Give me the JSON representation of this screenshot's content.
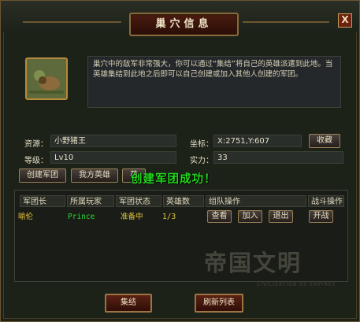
{
  "window": {
    "title": "巢穴信息",
    "close_label": "X",
    "description": "巢穴中的敌军非常强大，你可以通过“集结”将自己的英雄派遣到此地。当英雄集结到此地之后即可以自己创建或加入其他人创建的军团。"
  },
  "info": {
    "resource_label": "资源：",
    "resource_value": "小野猪王",
    "level_label": "等级：",
    "level_value": "Lv10",
    "coord_label": "坐标：",
    "coord_value": "X:2751,Y:607",
    "strength_label": "实力：",
    "strength_value": "33",
    "favorite_label": "收藏"
  },
  "tabs": [
    "创建军团",
    "我方英雄",
    "英"
  ],
  "message": "创建军团成功！",
  "table": {
    "headers": [
      "军团长",
      "所属玩家",
      "军团状态",
      "英雄数",
      "组队操作",
      "战斗操作"
    ],
    "rows": [
      {
        "leader": "喻伦",
        "player": "Prince",
        "status": "准备中",
        "count": "1/3",
        "actions": [
          "查看",
          "加入",
          "退出"
        ],
        "battle": "开战"
      }
    ]
  },
  "footer": {
    "assemble_label": "集结",
    "refresh_label": "刷新列表"
  },
  "watermark": {
    "main": "帝国文明",
    "sub": "CIVILIZATION OF EMPIRES"
  }
}
